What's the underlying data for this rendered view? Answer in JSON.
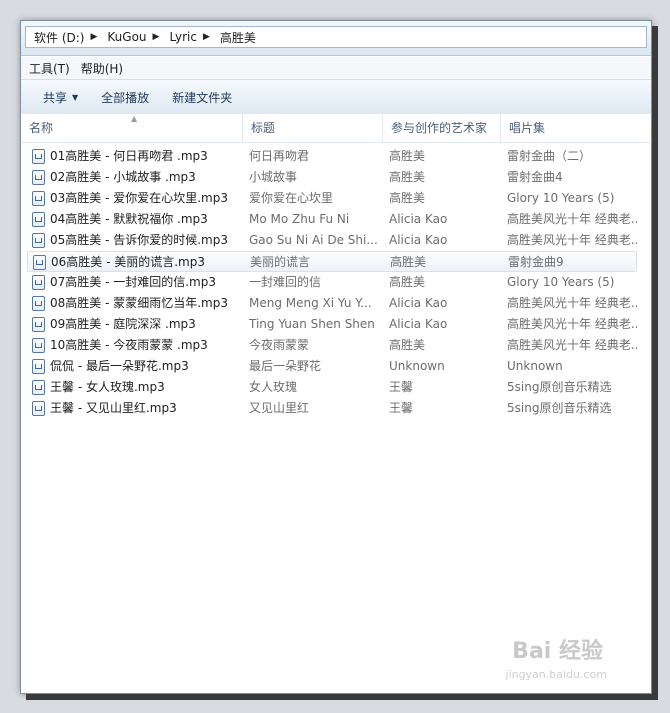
{
  "address": {
    "crumbs": [
      "软件 (D:)",
      "KuGou",
      "Lyric",
      "高胜美"
    ]
  },
  "menu": [
    "工具(T)",
    "帮助(H)"
  ],
  "toolbar": {
    "share_label": "共享",
    "play_all_label": "全部播放",
    "new_folder_label": "新建文件夹"
  },
  "columns": {
    "name": "名称",
    "title": "标题",
    "artist": "参与创作的艺术家",
    "album": "唱片集"
  },
  "files": [
    {
      "name": "01高胜美 - 何日再吻君 .mp3",
      "title": "何日再吻君",
      "artist": "高胜美",
      "album": "雷射金曲（二）"
    },
    {
      "name": "02高胜美 - 小城故事 .mp3",
      "title": "小城故事",
      "artist": "高胜美",
      "album": "雷射金曲4"
    },
    {
      "name": "03高胜美 - 爱你爱在心坎里.mp3",
      "title": "爱你爱在心坎里",
      "artist": "高胜美",
      "album": "Glory 10 Years (5)"
    },
    {
      "name": "04高胜美 - 默默祝福你 .mp3",
      "title": "Mo Mo Zhu Fu Ni",
      "artist": "Alicia Kao",
      "album": "高胜美风光十年 经典老..."
    },
    {
      "name": "05高胜美 - 告诉你爱的时候.mp3",
      "title": "Gao Su Ni Ai De Shi...",
      "artist": "Alicia Kao",
      "album": "高胜美风光十年 经典老..."
    },
    {
      "name": "06高胜美 - 美丽的谎言.mp3",
      "title": "美丽的谎言",
      "artist": "高胜美",
      "album": "雷射金曲9"
    },
    {
      "name": "07高胜美 - 一封难回的信.mp3",
      "title": "一封难回的信",
      "artist": "高胜美",
      "album": "Glory 10 Years (5)"
    },
    {
      "name": "08高胜美 - 蒙蒙细雨忆当年.mp3",
      "title": "Meng Meng Xi Yu Y...",
      "artist": "Alicia Kao",
      "album": "高胜美风光十年 经典老..."
    },
    {
      "name": "09高胜美 - 庭院深深 .mp3",
      "title": "Ting Yuan Shen Shen",
      "artist": "Alicia Kao",
      "album": "高胜美风光十年 经典老..."
    },
    {
      "name": "10高胜美 - 今夜雨蒙蒙 .mp3",
      "title": "今夜雨蒙蒙",
      "artist": "高胜美",
      "album": "高胜美风光十年 经典老..."
    },
    {
      "name": "侃侃 - 最后一朵野花.mp3",
      "title": "最后一朵野花",
      "artist": "Unknown",
      "album": "Unknown"
    },
    {
      "name": "王馨 - 女人玫瑰.mp3",
      "title": "女人玫瑰",
      "artist": "王馨",
      "album": "5sing原创音乐精选"
    },
    {
      "name": "王馨 - 又见山里红.mp3",
      "title": "又见山里红",
      "artist": "王馨",
      "album": "5sing原创音乐精选"
    }
  ],
  "hovered_row": 5,
  "watermark": {
    "logo_text": "Bai 经验",
    "url_text": "jingyan.baidu.com"
  }
}
